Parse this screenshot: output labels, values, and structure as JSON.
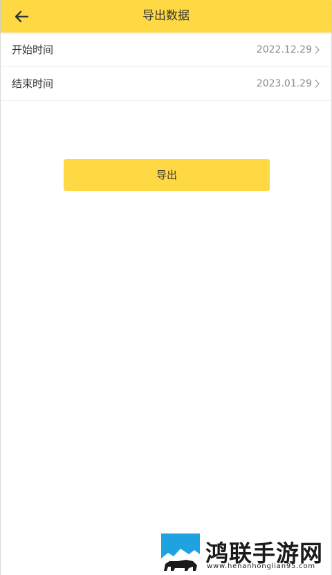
{
  "app_bar": {
    "title": "导出数据",
    "back_icon": "arrow-left-icon",
    "background": "#ffd943"
  },
  "rows": [
    {
      "label": "开始时间",
      "value": "2022.12.29",
      "icon": "chevron-right-icon"
    },
    {
      "label": "结束时间",
      "value": "2023.01.29",
      "icon": "chevron-right-icon"
    }
  ],
  "export_button": {
    "label": "导出",
    "background": "#ffd943"
  },
  "watermark": {
    "title": "鸿联手游网",
    "url": "www.henanhonglian95.com",
    "logo_icon": "bull-logo-icon",
    "logo_color": "#1fa3e0"
  }
}
